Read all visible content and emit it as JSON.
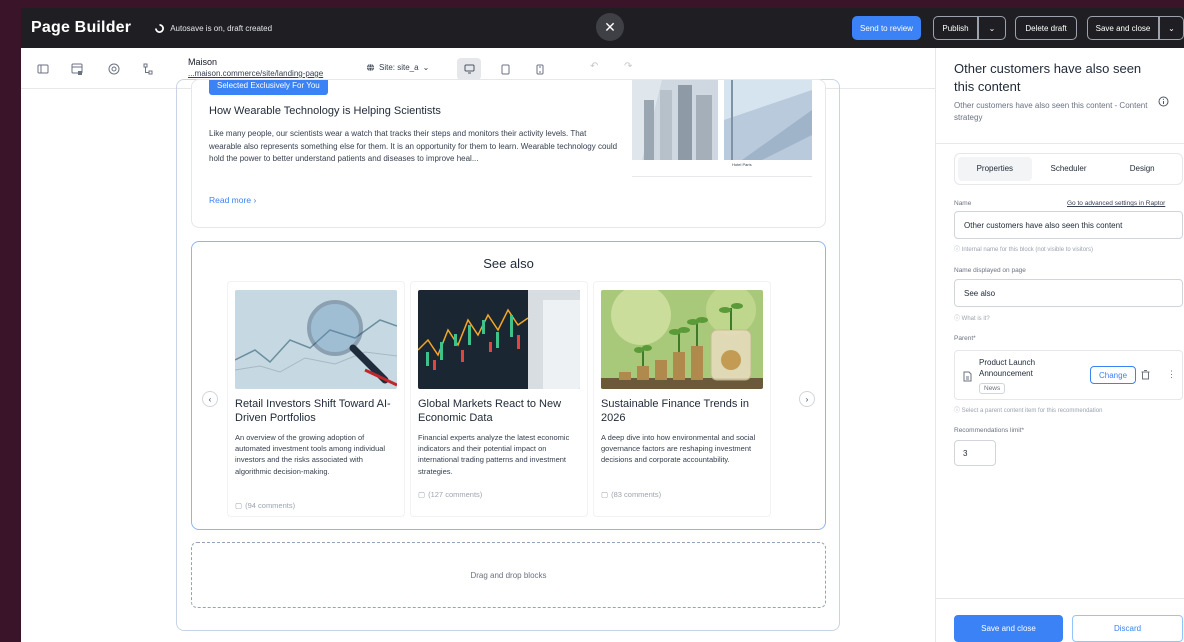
{
  "header": {
    "app_title": "Page Builder",
    "autosave": "Autosave is on, draft created",
    "close_icon": "close-icon",
    "send_to_review": "Send to review",
    "publish": "Publish",
    "delete_draft": "Delete draft",
    "save_and_close": "Save and close",
    "accent_color": "#3b82f6",
    "bar_color": "#1f1f23"
  },
  "toolbar": {
    "site_name": "Maison",
    "site_url": "...maison.commerce/site/landing-page",
    "site_select": "Site: site_a",
    "icons": [
      "layout-icon",
      "blocks-icon",
      "at-icon",
      "tree-icon",
      "desktop-icon",
      "tablet-icon",
      "mobile-icon",
      "undo-icon",
      "redo-icon"
    ]
  },
  "article": {
    "badge": "Selected Exclusively For You",
    "title": "How Wearable Technology is Helping Scientists",
    "body": "Like many people, our scientists wear a watch that tracks their steps and monitors their activity levels. That wearable also represents something else for them. It is an opportunity for them to learn. Wearable technology could hold the power to better understand patients and diseases to improve heal...",
    "read_more": "Read more",
    "image_caption": "Hotel Paris"
  },
  "see_also": {
    "title": "See also",
    "cards": [
      {
        "title": "Retail Investors Shift Toward AI-Driven Portfolios",
        "description": "An overview of the growing adoption of automated investment tools among individual investors and the risks associated with algorithmic decision-making.",
        "comments": "(94 comments)"
      },
      {
        "title": "Global Markets React to New Economic Data",
        "description": "Financial experts analyze the latest economic indicators and their potential impact on international trading patterns and investment strategies.",
        "comments": "(127 comments)"
      },
      {
        "title": "Sustainable Finance Trends in 2026",
        "description": "A deep dive into how environmental and social governance factors are reshaping investment decisions and corporate accountability.",
        "comments": "(83 comments)"
      }
    ]
  },
  "dropzone": {
    "label": "Drag and drop blocks"
  },
  "panel": {
    "title": "Other customers have also seen this content",
    "subtitle": "Other customers have also seen this content - Content strategy",
    "tabs": [
      "Properties",
      "Scheduler",
      "Design"
    ],
    "name_label": "Name",
    "advanced_link": "Go to advanced settings in Raptor",
    "name_value": "Other customers have also seen this content",
    "name_hint": "Internal name for this block (not visible to visitors)",
    "display_label": "Name displayed on page",
    "display_value": "See also",
    "display_hint": "What is it?",
    "parent_label": "Parent*",
    "parent_name": "Product Launch Announcement",
    "parent_tag": "News",
    "change_btn": "Change",
    "parent_hint": "Select a parent content item for this recommendation",
    "limit_label": "Recommendations limit*",
    "limit_value": "3",
    "save_and_close": "Save and close",
    "discard": "Discard"
  }
}
